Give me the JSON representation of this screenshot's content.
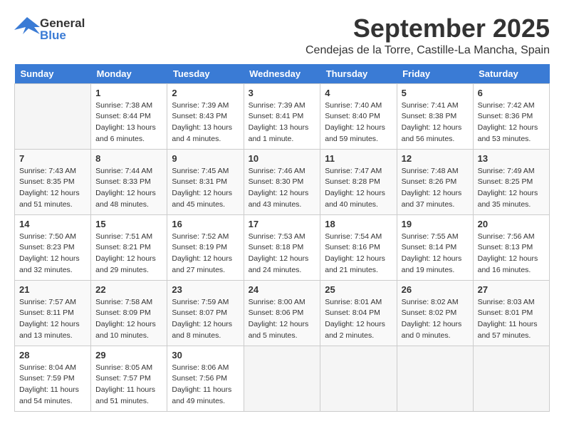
{
  "header": {
    "logo_general": "General",
    "logo_blue": "Blue",
    "month_title": "September 2025",
    "location": "Cendejas de la Torre, Castille-La Mancha, Spain"
  },
  "weekdays": [
    "Sunday",
    "Monday",
    "Tuesday",
    "Wednesday",
    "Thursday",
    "Friday",
    "Saturday"
  ],
  "weeks": [
    [
      {
        "day": "",
        "info": ""
      },
      {
        "day": "1",
        "info": "Sunrise: 7:38 AM\nSunset: 8:44 PM\nDaylight: 13 hours\nand 6 minutes."
      },
      {
        "day": "2",
        "info": "Sunrise: 7:39 AM\nSunset: 8:43 PM\nDaylight: 13 hours\nand 4 minutes."
      },
      {
        "day": "3",
        "info": "Sunrise: 7:39 AM\nSunset: 8:41 PM\nDaylight: 13 hours\nand 1 minute."
      },
      {
        "day": "4",
        "info": "Sunrise: 7:40 AM\nSunset: 8:40 PM\nDaylight: 12 hours\nand 59 minutes."
      },
      {
        "day": "5",
        "info": "Sunrise: 7:41 AM\nSunset: 8:38 PM\nDaylight: 12 hours\nand 56 minutes."
      },
      {
        "day": "6",
        "info": "Sunrise: 7:42 AM\nSunset: 8:36 PM\nDaylight: 12 hours\nand 53 minutes."
      }
    ],
    [
      {
        "day": "7",
        "info": "Sunrise: 7:43 AM\nSunset: 8:35 PM\nDaylight: 12 hours\nand 51 minutes."
      },
      {
        "day": "8",
        "info": "Sunrise: 7:44 AM\nSunset: 8:33 PM\nDaylight: 12 hours\nand 48 minutes."
      },
      {
        "day": "9",
        "info": "Sunrise: 7:45 AM\nSunset: 8:31 PM\nDaylight: 12 hours\nand 45 minutes."
      },
      {
        "day": "10",
        "info": "Sunrise: 7:46 AM\nSunset: 8:30 PM\nDaylight: 12 hours\nand 43 minutes."
      },
      {
        "day": "11",
        "info": "Sunrise: 7:47 AM\nSunset: 8:28 PM\nDaylight: 12 hours\nand 40 minutes."
      },
      {
        "day": "12",
        "info": "Sunrise: 7:48 AM\nSunset: 8:26 PM\nDaylight: 12 hours\nand 37 minutes."
      },
      {
        "day": "13",
        "info": "Sunrise: 7:49 AM\nSunset: 8:25 PM\nDaylight: 12 hours\nand 35 minutes."
      }
    ],
    [
      {
        "day": "14",
        "info": "Sunrise: 7:50 AM\nSunset: 8:23 PM\nDaylight: 12 hours\nand 32 minutes."
      },
      {
        "day": "15",
        "info": "Sunrise: 7:51 AM\nSunset: 8:21 PM\nDaylight: 12 hours\nand 29 minutes."
      },
      {
        "day": "16",
        "info": "Sunrise: 7:52 AM\nSunset: 8:19 PM\nDaylight: 12 hours\nand 27 minutes."
      },
      {
        "day": "17",
        "info": "Sunrise: 7:53 AM\nSunset: 8:18 PM\nDaylight: 12 hours\nand 24 minutes."
      },
      {
        "day": "18",
        "info": "Sunrise: 7:54 AM\nSunset: 8:16 PM\nDaylight: 12 hours\nand 21 minutes."
      },
      {
        "day": "19",
        "info": "Sunrise: 7:55 AM\nSunset: 8:14 PM\nDaylight: 12 hours\nand 19 minutes."
      },
      {
        "day": "20",
        "info": "Sunrise: 7:56 AM\nSunset: 8:13 PM\nDaylight: 12 hours\nand 16 minutes."
      }
    ],
    [
      {
        "day": "21",
        "info": "Sunrise: 7:57 AM\nSunset: 8:11 PM\nDaylight: 12 hours\nand 13 minutes."
      },
      {
        "day": "22",
        "info": "Sunrise: 7:58 AM\nSunset: 8:09 PM\nDaylight: 12 hours\nand 10 minutes."
      },
      {
        "day": "23",
        "info": "Sunrise: 7:59 AM\nSunset: 8:07 PM\nDaylight: 12 hours\nand 8 minutes."
      },
      {
        "day": "24",
        "info": "Sunrise: 8:00 AM\nSunset: 8:06 PM\nDaylight: 12 hours\nand 5 minutes."
      },
      {
        "day": "25",
        "info": "Sunrise: 8:01 AM\nSunset: 8:04 PM\nDaylight: 12 hours\nand 2 minutes."
      },
      {
        "day": "26",
        "info": "Sunrise: 8:02 AM\nSunset: 8:02 PM\nDaylight: 12 hours\nand 0 minutes."
      },
      {
        "day": "27",
        "info": "Sunrise: 8:03 AM\nSunset: 8:01 PM\nDaylight: 11 hours\nand 57 minutes."
      }
    ],
    [
      {
        "day": "28",
        "info": "Sunrise: 8:04 AM\nSunset: 7:59 PM\nDaylight: 11 hours\nand 54 minutes."
      },
      {
        "day": "29",
        "info": "Sunrise: 8:05 AM\nSunset: 7:57 PM\nDaylight: 11 hours\nand 51 minutes."
      },
      {
        "day": "30",
        "info": "Sunrise: 8:06 AM\nSunset: 7:56 PM\nDaylight: 11 hours\nand 49 minutes."
      },
      {
        "day": "",
        "info": ""
      },
      {
        "day": "",
        "info": ""
      },
      {
        "day": "",
        "info": ""
      },
      {
        "day": "",
        "info": ""
      }
    ]
  ]
}
